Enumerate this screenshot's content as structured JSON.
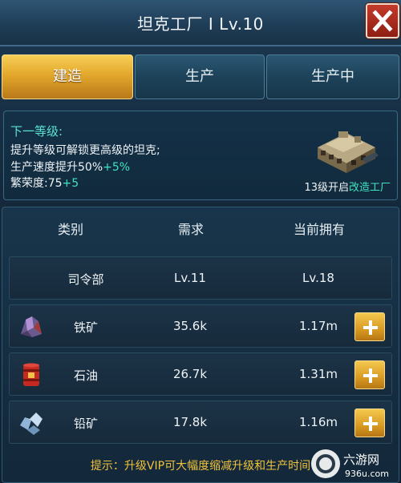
{
  "window": {
    "title": "坦克工厂 I  Lv.10"
  },
  "tabs": [
    {
      "label": "建造",
      "active": true
    },
    {
      "label": "生产",
      "active": false
    },
    {
      "label": "生产中",
      "active": false
    }
  ],
  "info": {
    "heading": "下一等级:",
    "line1": "提升等级可解锁更高级的坦克;",
    "line2_text": "生产速度提升50%",
    "line2_bonus": "+5%",
    "line3_text": "繁荣度:75",
    "line3_bonus": "+5",
    "unlock_text": "13级开启",
    "unlock_link": "改造工厂"
  },
  "table": {
    "headers": [
      "类别",
      "需求",
      "当前拥有"
    ],
    "rows": [
      {
        "name": "司令部",
        "required": "Lv.11",
        "owned": "Lv.18",
        "icon": "",
        "has_plus": false
      },
      {
        "name": "铁矿",
        "required": "35.6k",
        "owned": "1.17m",
        "icon": "iron-ore-icon",
        "has_plus": true
      },
      {
        "name": "石油",
        "required": "26.7k",
        "owned": "1.31m",
        "icon": "oil-barrel-icon",
        "has_plus": true
      },
      {
        "name": "铅矿",
        "required": "17.8k",
        "owned": "1.16m",
        "icon": "lead-ore-icon",
        "has_plus": true
      }
    ]
  },
  "tip": "提示：升级VIP可大幅度缩减升级和生产时间",
  "watermark": {
    "text": "六游网",
    "sub": "936u.com"
  },
  "colors": {
    "accent_gold": "#e3a82c",
    "highlight_green": "#3fe3c0",
    "tip_gold": "#f0c23a",
    "close_red": "#c43a2a"
  }
}
